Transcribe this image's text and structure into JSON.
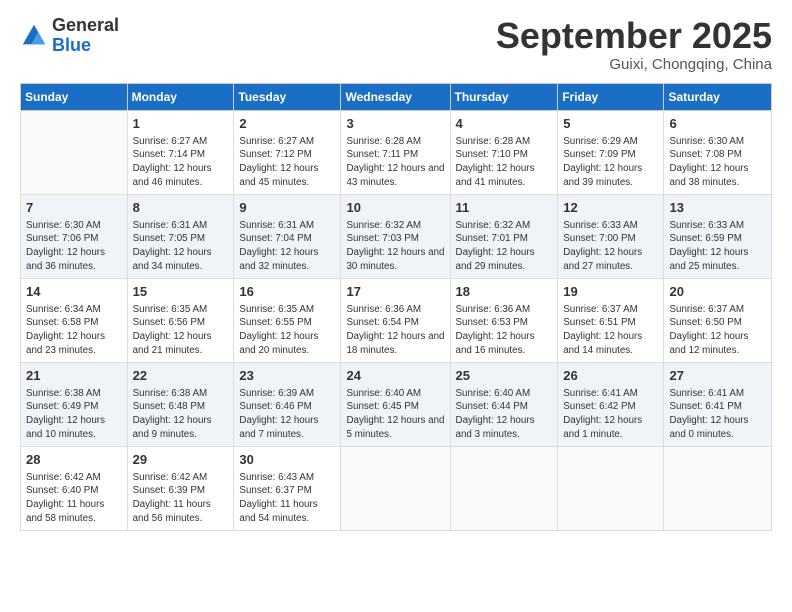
{
  "logo": {
    "general": "General",
    "blue": "Blue"
  },
  "header": {
    "month": "September 2025",
    "location": "Guixi, Chongqing, China"
  },
  "days_of_week": [
    "Sunday",
    "Monday",
    "Tuesday",
    "Wednesday",
    "Thursday",
    "Friday",
    "Saturday"
  ],
  "weeks": [
    [
      {
        "day": "",
        "info": ""
      },
      {
        "day": "1",
        "info": "Sunrise: 6:27 AM\nSunset: 7:14 PM\nDaylight: 12 hours and 46 minutes."
      },
      {
        "day": "2",
        "info": "Sunrise: 6:27 AM\nSunset: 7:12 PM\nDaylight: 12 hours and 45 minutes."
      },
      {
        "day": "3",
        "info": "Sunrise: 6:28 AM\nSunset: 7:11 PM\nDaylight: 12 hours and 43 minutes."
      },
      {
        "day": "4",
        "info": "Sunrise: 6:28 AM\nSunset: 7:10 PM\nDaylight: 12 hours and 41 minutes."
      },
      {
        "day": "5",
        "info": "Sunrise: 6:29 AM\nSunset: 7:09 PM\nDaylight: 12 hours and 39 minutes."
      },
      {
        "day": "6",
        "info": "Sunrise: 6:30 AM\nSunset: 7:08 PM\nDaylight: 12 hours and 38 minutes."
      }
    ],
    [
      {
        "day": "7",
        "info": "Sunrise: 6:30 AM\nSunset: 7:06 PM\nDaylight: 12 hours and 36 minutes."
      },
      {
        "day": "8",
        "info": "Sunrise: 6:31 AM\nSunset: 7:05 PM\nDaylight: 12 hours and 34 minutes."
      },
      {
        "day": "9",
        "info": "Sunrise: 6:31 AM\nSunset: 7:04 PM\nDaylight: 12 hours and 32 minutes."
      },
      {
        "day": "10",
        "info": "Sunrise: 6:32 AM\nSunset: 7:03 PM\nDaylight: 12 hours and 30 minutes."
      },
      {
        "day": "11",
        "info": "Sunrise: 6:32 AM\nSunset: 7:01 PM\nDaylight: 12 hours and 29 minutes."
      },
      {
        "day": "12",
        "info": "Sunrise: 6:33 AM\nSunset: 7:00 PM\nDaylight: 12 hours and 27 minutes."
      },
      {
        "day": "13",
        "info": "Sunrise: 6:33 AM\nSunset: 6:59 PM\nDaylight: 12 hours and 25 minutes."
      }
    ],
    [
      {
        "day": "14",
        "info": "Sunrise: 6:34 AM\nSunset: 6:58 PM\nDaylight: 12 hours and 23 minutes."
      },
      {
        "day": "15",
        "info": "Sunrise: 6:35 AM\nSunset: 6:56 PM\nDaylight: 12 hours and 21 minutes."
      },
      {
        "day": "16",
        "info": "Sunrise: 6:35 AM\nSunset: 6:55 PM\nDaylight: 12 hours and 20 minutes."
      },
      {
        "day": "17",
        "info": "Sunrise: 6:36 AM\nSunset: 6:54 PM\nDaylight: 12 hours and 18 minutes."
      },
      {
        "day": "18",
        "info": "Sunrise: 6:36 AM\nSunset: 6:53 PM\nDaylight: 12 hours and 16 minutes."
      },
      {
        "day": "19",
        "info": "Sunrise: 6:37 AM\nSunset: 6:51 PM\nDaylight: 12 hours and 14 minutes."
      },
      {
        "day": "20",
        "info": "Sunrise: 6:37 AM\nSunset: 6:50 PM\nDaylight: 12 hours and 12 minutes."
      }
    ],
    [
      {
        "day": "21",
        "info": "Sunrise: 6:38 AM\nSunset: 6:49 PM\nDaylight: 12 hours and 10 minutes."
      },
      {
        "day": "22",
        "info": "Sunrise: 6:38 AM\nSunset: 6:48 PM\nDaylight: 12 hours and 9 minutes."
      },
      {
        "day": "23",
        "info": "Sunrise: 6:39 AM\nSunset: 6:46 PM\nDaylight: 12 hours and 7 minutes."
      },
      {
        "day": "24",
        "info": "Sunrise: 6:40 AM\nSunset: 6:45 PM\nDaylight: 12 hours and 5 minutes."
      },
      {
        "day": "25",
        "info": "Sunrise: 6:40 AM\nSunset: 6:44 PM\nDaylight: 12 hours and 3 minutes."
      },
      {
        "day": "26",
        "info": "Sunrise: 6:41 AM\nSunset: 6:42 PM\nDaylight: 12 hours and 1 minute."
      },
      {
        "day": "27",
        "info": "Sunrise: 6:41 AM\nSunset: 6:41 PM\nDaylight: 12 hours and 0 minutes."
      }
    ],
    [
      {
        "day": "28",
        "info": "Sunrise: 6:42 AM\nSunset: 6:40 PM\nDaylight: 11 hours and 58 minutes."
      },
      {
        "day": "29",
        "info": "Sunrise: 6:42 AM\nSunset: 6:39 PM\nDaylight: 11 hours and 56 minutes."
      },
      {
        "day": "30",
        "info": "Sunrise: 6:43 AM\nSunset: 6:37 PM\nDaylight: 11 hours and 54 minutes."
      },
      {
        "day": "",
        "info": ""
      },
      {
        "day": "",
        "info": ""
      },
      {
        "day": "",
        "info": ""
      },
      {
        "day": "",
        "info": ""
      }
    ]
  ]
}
